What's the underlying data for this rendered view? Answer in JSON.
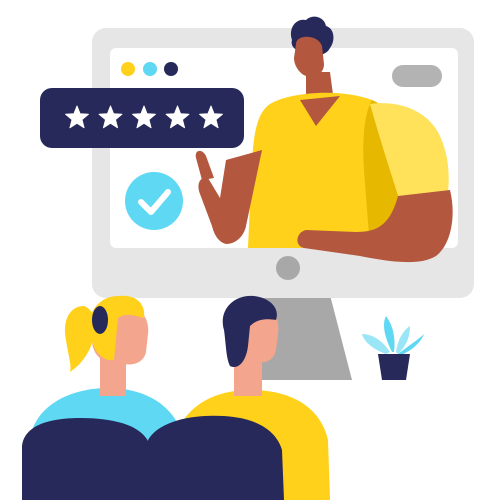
{
  "illustration": {
    "subject": "online-course-rating",
    "rating": {
      "stars_filled": 5,
      "stars_total": 5
    }
  },
  "icons": {
    "rating": "star-icon",
    "confirmation": "checkmark-icon",
    "plant": "potted-plant-icon"
  },
  "colors": {
    "navy": "#26295a",
    "yellow": "#ffd11a",
    "yellow_light": "#ffe25a",
    "yellow_shadow": "#e6b800",
    "cyan": "#5fd8f3",
    "skin_dark": "#b3573e",
    "skin_light": "#f4a58e",
    "monitor_frame": "#e6e6e6",
    "screen": "#ffffff",
    "stand": "#a8a8a8",
    "dot_yellow": "#ffd11a",
    "dot_cyan": "#5fd8f3",
    "dot_navy": "#26295a",
    "star": "#ffffff"
  }
}
